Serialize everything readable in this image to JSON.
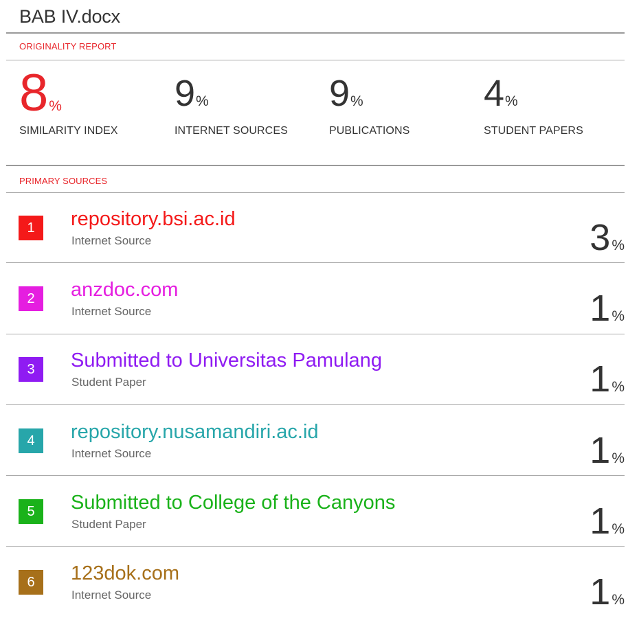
{
  "document": {
    "title": "BAB IV.docx"
  },
  "report": {
    "section_label": "ORIGINALITY REPORT",
    "stats": [
      {
        "value": "8",
        "unit": "%",
        "label": "SIMILARITY INDEX",
        "color": "#e8262b"
      },
      {
        "value": "9",
        "unit": "%",
        "label": "INTERNET SOURCES",
        "color": "#333333"
      },
      {
        "value": "9",
        "unit": "%",
        "label": "PUBLICATIONS",
        "color": "#333333"
      },
      {
        "value": "4",
        "unit": "%",
        "label": "STUDENT PAPERS",
        "color": "#333333"
      }
    ]
  },
  "primary_sources": {
    "section_label": "PRIMARY SOURCES",
    "items": [
      {
        "number": "1",
        "name": "repository.bsi.ac.id",
        "type": "Internet Source",
        "percent": "3",
        "unit": "%",
        "color": "#f41919"
      },
      {
        "number": "2",
        "name": "anzdoc.com",
        "type": "Internet Source",
        "percent": "1",
        "unit": "%",
        "color": "#e51ee0"
      },
      {
        "number": "3",
        "name": "Submitted to Universitas Pamulang",
        "type": "Student Paper",
        "percent": "1",
        "unit": "%",
        "color": "#8f1bf2"
      },
      {
        "number": "4",
        "name": "repository.nusamandiri.ac.id",
        "type": "Internet Source",
        "percent": "1",
        "unit": "%",
        "color": "#27a6aa"
      },
      {
        "number": "5",
        "name": "Submitted to College of the Canyons",
        "type": "Student Paper",
        "percent": "1",
        "unit": "%",
        "color": "#1ab21a"
      },
      {
        "number": "6",
        "name": "123dok.com",
        "type": "Internet Source",
        "percent": "1",
        "unit": "%",
        "color": "#a7701a"
      }
    ]
  }
}
